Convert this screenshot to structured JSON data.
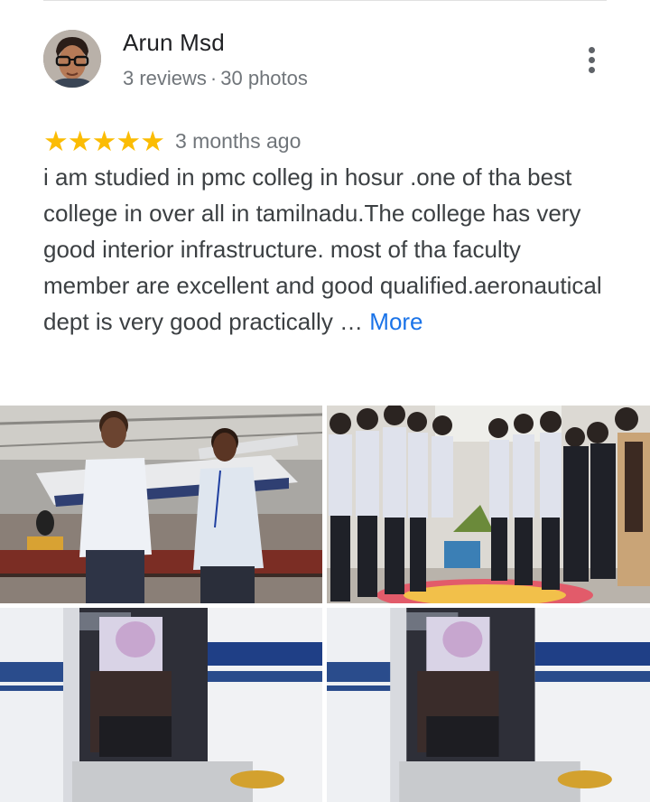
{
  "review": {
    "author_name": "Arun Msd",
    "review_count": "3 reviews",
    "separator": "·",
    "photo_count": "30 photos",
    "rating": 5,
    "date": "3 months ago",
    "text": "i am studied in pmc colleg in hosur .one of tha best college in over all in tamilnadu.The college has very good interior infrastructure. most of tha faculty member are excellent and good qualified.aeronautical dept is very good practically … ",
    "more_label": "More"
  },
  "icons": {
    "overflow": "more-vert-icon",
    "star": "star-icon"
  },
  "colors": {
    "star": "#fbbc04",
    "link": "#1a73e8",
    "secondary_text": "#70757a"
  },
  "photos": [
    {
      "subject": "two students standing beside a small aircraft in a hangar"
    },
    {
      "subject": "group of students around a decorated floor setup"
    },
    {
      "subject": "person seated in aircraft cockpit through open door"
    },
    {
      "subject": "person seated in aircraft cockpit through open door"
    }
  ]
}
